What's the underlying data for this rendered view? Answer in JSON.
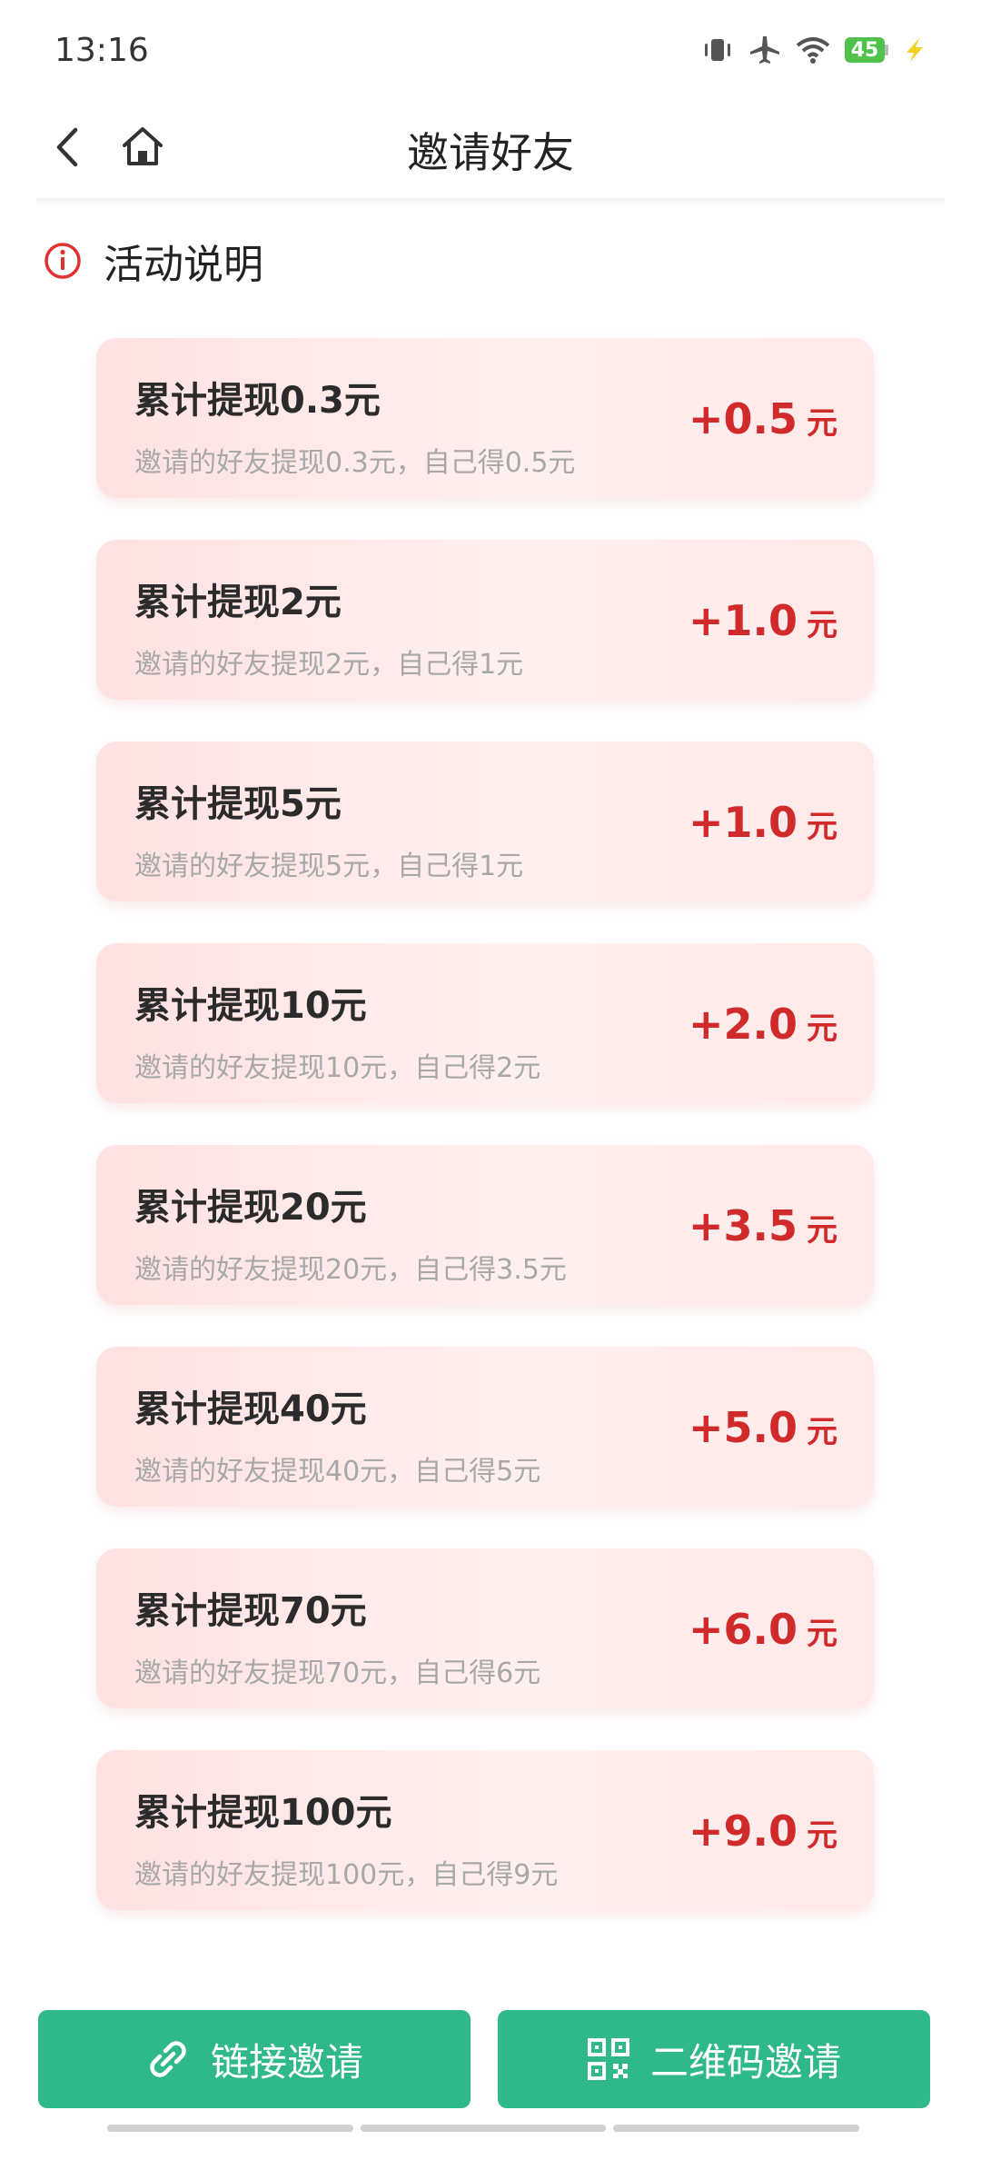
{
  "status_bar": {
    "time": "13:16",
    "battery_level": "45",
    "icons": [
      "vibrate-icon",
      "airplane-icon",
      "wifi-icon",
      "battery-icon",
      "charging-icon"
    ]
  },
  "header": {
    "title": "邀请好友"
  },
  "section": {
    "title": "活动说明",
    "icon": "info-icon"
  },
  "rewards": [
    {
      "title": "累计提现0.3元",
      "desc": "邀请的好友提现0.3元，自己得0.5元",
      "amount": "+0.5",
      "unit": "元"
    },
    {
      "title": "累计提现2元",
      "desc": "邀请的好友提现2元，自己得1元",
      "amount": "+1.0",
      "unit": "元"
    },
    {
      "title": "累计提现5元",
      "desc": "邀请的好友提现5元，自己得1元",
      "amount": "+1.0",
      "unit": "元"
    },
    {
      "title": "累计提现10元",
      "desc": "邀请的好友提现10元，自己得2元",
      "amount": "+2.0",
      "unit": "元"
    },
    {
      "title": "累计提现20元",
      "desc": "邀请的好友提现20元，自己得3.5元",
      "amount": "+3.5",
      "unit": "元"
    },
    {
      "title": "累计提现40元",
      "desc": "邀请的好友提现40元，自己得5元",
      "amount": "+5.0",
      "unit": "元"
    },
    {
      "title": "累计提现70元",
      "desc": "邀请的好友提现70元，自己得6元",
      "amount": "+6.0",
      "unit": "元"
    },
    {
      "title": "累计提现100元",
      "desc": "邀请的好友提现100元，自己得9元",
      "amount": "+9.0",
      "unit": "元"
    }
  ],
  "buttons": {
    "link_invite": "链接邀请",
    "qr_invite": "二维码邀请"
  },
  "colors": {
    "accent_green": "#2fb88a",
    "reward_red": "#d12a2a",
    "card_bg": "#ffe8e8",
    "info_red": "#e03131"
  }
}
